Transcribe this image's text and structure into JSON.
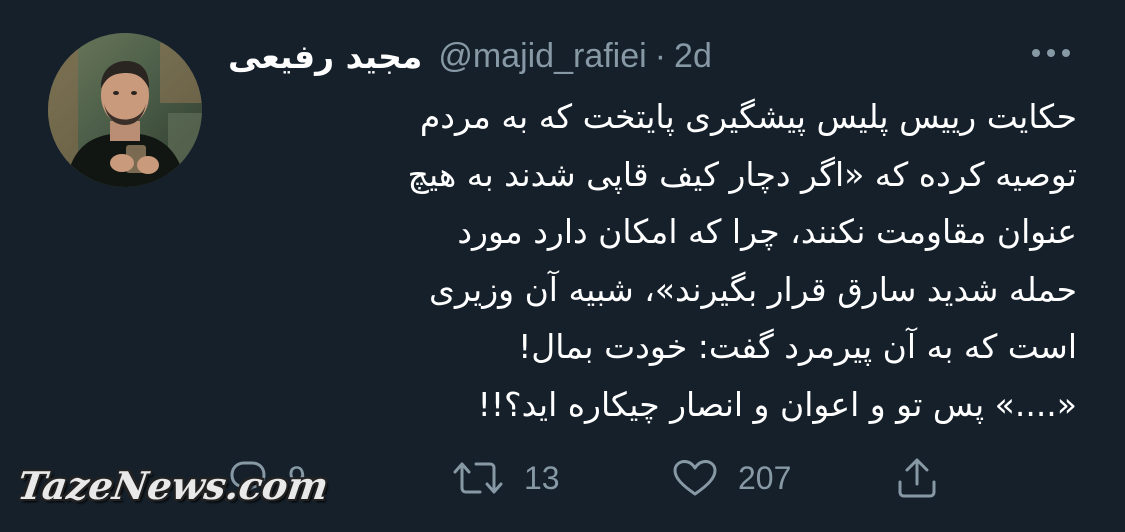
{
  "tweet": {
    "author_name": "مجید رفیعی",
    "handle": "@majid_rafiei",
    "separator": "·",
    "time": "2d",
    "more_icon": "more-horizontal-icon",
    "text_lines": [
      "حکایت رییس پلیس پیشگیری پایتخت که به مردم",
      "توصیه کرده که «اگر دچار کیف قاپی شدند به هیچ",
      "عنوان مقاومت نکنند، چرا که امکان دارد مورد",
      "حمله شدید سارق قرار بگیرند»، شبیه آن وزیری",
      "است که به آن پیرمرد گفت: خودت بمال!",
      "«....» پس تو و اعوان و انصار چیکاره اید؟!!"
    ]
  },
  "actions": {
    "reply": {
      "icon": "reply-icon",
      "count": "9"
    },
    "retweet": {
      "icon": "retweet-icon",
      "count": "13"
    },
    "like": {
      "icon": "heart-icon",
      "count": "207"
    },
    "share": {
      "icon": "share-icon"
    }
  },
  "watermark": {
    "text": "TazeNews.com"
  },
  "colors": {
    "background": "#15202b",
    "text": "#ffffff",
    "secondary": "#8899a6"
  }
}
